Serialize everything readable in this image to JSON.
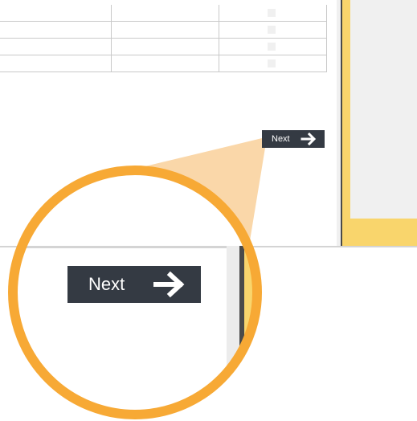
{
  "table": {
    "rows": [
      {
        "c1": "",
        "c2": "",
        "c3": ""
      },
      {
        "c1": "",
        "c2": "",
        "c3": ""
      },
      {
        "c1": "",
        "c2": "",
        "c3": ""
      },
      {
        "c1": "",
        "c2": "",
        "c3": ""
      }
    ]
  },
  "button": {
    "label": "Next",
    "icon": "arrow-right-icon",
    "background": "#343a43",
    "text_color": "#ffffff"
  },
  "zoom": {
    "label": "Next",
    "ring_color": "#f7a935",
    "beam_color": "#f9d3a0"
  },
  "panel": {
    "accent": "#f9d56c"
  }
}
